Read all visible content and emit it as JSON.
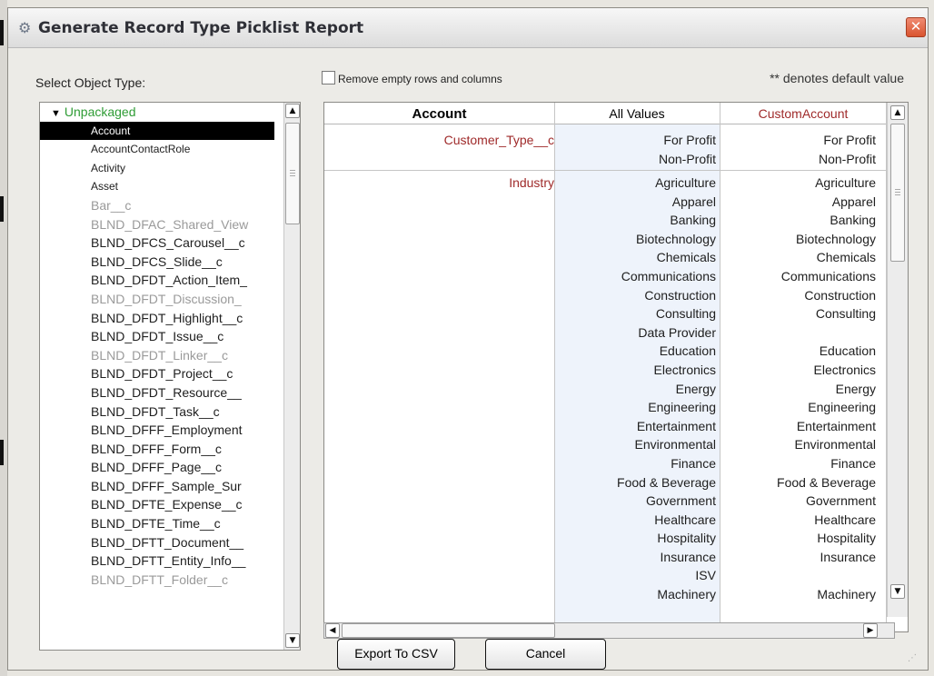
{
  "window": {
    "title": "Generate Record Type Picklist Report",
    "close_icon": "close-icon",
    "title_icon": "gear-icon"
  },
  "labels": {
    "select_object_type": "Select Object Type:",
    "remove_empty": "Remove empty rows and columns",
    "remove_empty_checked": false,
    "default_note": "** denotes default value"
  },
  "tree": {
    "root_label": "Unpackaged",
    "items": [
      {
        "label": "Account",
        "state": "selected"
      },
      {
        "label": "AccountContactRole",
        "state": "normal"
      },
      {
        "label": "Activity",
        "state": "normal"
      },
      {
        "label": "Asset",
        "state": "normal"
      },
      {
        "label": "Bar__c",
        "state": "disabled"
      },
      {
        "label": "BLND_DFAC_Shared_View",
        "state": "disabled"
      },
      {
        "label": "BLND_DFCS_Carousel__c",
        "state": "normal"
      },
      {
        "label": "BLND_DFCS_Slide__c",
        "state": "normal"
      },
      {
        "label": "BLND_DFDT_Action_Item_",
        "state": "normal"
      },
      {
        "label": "BLND_DFDT_Discussion_",
        "state": "disabled"
      },
      {
        "label": "BLND_DFDT_Highlight__c",
        "state": "normal"
      },
      {
        "label": "BLND_DFDT_Issue__c",
        "state": "normal"
      },
      {
        "label": "BLND_DFDT_Linker__c",
        "state": "disabled"
      },
      {
        "label": "BLND_DFDT_Project__c",
        "state": "normal"
      },
      {
        "label": "BLND_DFDT_Resource__",
        "state": "normal"
      },
      {
        "label": "BLND_DFDT_Task__c",
        "state": "normal"
      },
      {
        "label": "BLND_DFFF_Employment",
        "state": "normal"
      },
      {
        "label": "BLND_DFFF_Form__c",
        "state": "normal"
      },
      {
        "label": "BLND_DFFF_Page__c",
        "state": "normal"
      },
      {
        "label": "BLND_DFFF_Sample_Sur",
        "state": "normal"
      },
      {
        "label": "BLND_DFTE_Expense__c",
        "state": "normal"
      },
      {
        "label": "BLND_DFTE_Time__c",
        "state": "normal"
      },
      {
        "label": "BLND_DFTT_Document__",
        "state": "normal"
      },
      {
        "label": "BLND_DFTT_Entity_Info__",
        "state": "normal"
      },
      {
        "label": "BLND_DFTT_Folder__c",
        "state": "disabled"
      }
    ]
  },
  "grid": {
    "headers": {
      "object": "Account",
      "all_values": "All Values",
      "custom": "CustomAccount"
    },
    "rows": [
      {
        "field": "Customer_Type__c",
        "all_values": [
          "For Profit",
          "Non-Profit"
        ],
        "custom_values": [
          "For Profit",
          "Non-Profit"
        ]
      },
      {
        "field": "Industry",
        "all_values": [
          "Agriculture",
          "Apparel",
          "Banking",
          "Biotechnology",
          "Chemicals",
          "Communications",
          "Construction",
          "Consulting",
          "Data Provider",
          "Education",
          "Electronics",
          "Energy",
          "Engineering",
          "Entertainment",
          "Environmental",
          "Finance",
          "Food & Beverage",
          "Government",
          "Healthcare",
          "Hospitality",
          "Insurance",
          "ISV",
          "Machinery"
        ],
        "custom_values": [
          "Agriculture",
          "Apparel",
          "Banking",
          "Biotechnology",
          "Chemicals",
          "Communications",
          "Construction",
          "Consulting",
          "",
          "Education",
          "Electronics",
          "Energy",
          "Engineering",
          "Entertainment",
          "Environmental",
          "Finance",
          "Food & Beverage",
          "Government",
          "Healthcare",
          "Hospitality",
          "Insurance",
          "",
          "Machinery"
        ]
      }
    ]
  },
  "buttons": {
    "export": "Export To CSV",
    "cancel": "Cancel"
  }
}
